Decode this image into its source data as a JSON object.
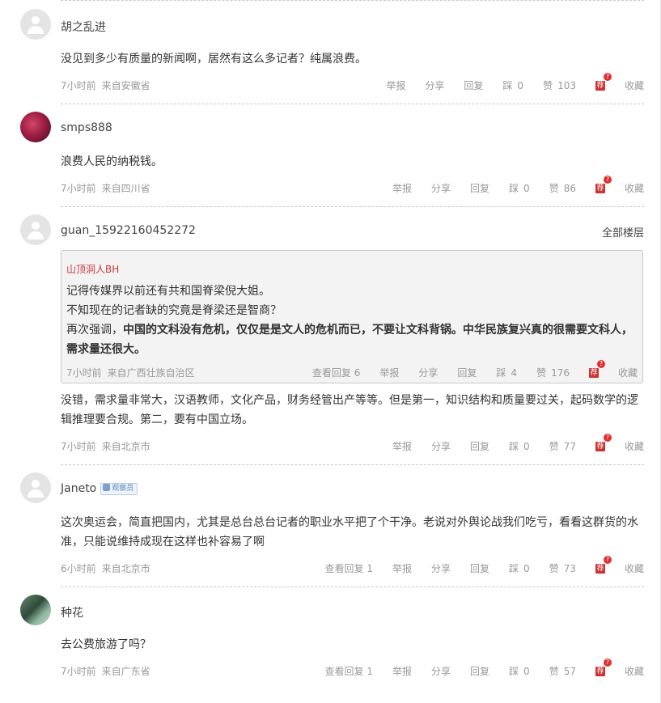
{
  "actions": {
    "report": "举报",
    "share": "分享",
    "reply": "回复",
    "dislike": "踩",
    "like": "赞",
    "recommend": "荐",
    "recommend_badge": "?",
    "collect": "收藏"
  },
  "comments": [
    {
      "user": "胡之乱进",
      "content": "没见到多少有质量的新闻啊，居然有这么多记者？纯属浪费。",
      "time": "7小时前",
      "location": "来自安徽省",
      "dislikes": "0",
      "likes": "103"
    },
    {
      "user": "smps888",
      "content": "浪费人民的纳税钱。",
      "time": "7小时前",
      "location": "来自四川省",
      "dislikes": "0",
      "likes": "86"
    },
    {
      "user": "guan_15922160452272",
      "all_floors": "全部楼层",
      "quote": {
        "user": "山顶洞人BH",
        "line1": "记得传媒界以前还有共和国脊梁倪大姐。",
        "line2": "不知现在的记者缺的究竟是脊梁还是智商？",
        "line3_normal": "再次强调，",
        "line3_bold": "中国的文科没有危机，仅仅是是文人的危机而已，不要让文科背锅。中华民族复兴真的很需要文科人，需求量还很大。",
        "time": "7小时前",
        "location": "来自广西壮族自治区",
        "view_replies": "查看回复 6",
        "dislikes": "4",
        "likes": "176"
      },
      "content": "没错，需求量非常大，汉语教师，文化产品，财务经管出产等等。但是第一，知识结构和质量要过关，起码数学的逻辑推理要合规。第二，要有中国立场。",
      "time": "7小时前",
      "location": "来自北京市",
      "dislikes": "0",
      "likes": "77"
    },
    {
      "user": "Janeto",
      "badge": "观察员",
      "content": "这次奥运会，简直把国内，尤其是总台总台记者的职业水平把了个干净。老说对外舆论战我们吃亏，看看这群货的水准，只能说维持成现在这样也补容易了啊",
      "time": "6小时前",
      "location": "来自北京市",
      "view_replies": "查看回复 1",
      "dislikes": "0",
      "likes": "73"
    },
    {
      "user": "种花",
      "content": "去公费旅游了吗？",
      "time": "7小时前",
      "location": "来自广东省",
      "view_replies": "查看回复 1",
      "dislikes": "0",
      "likes": "57"
    }
  ]
}
